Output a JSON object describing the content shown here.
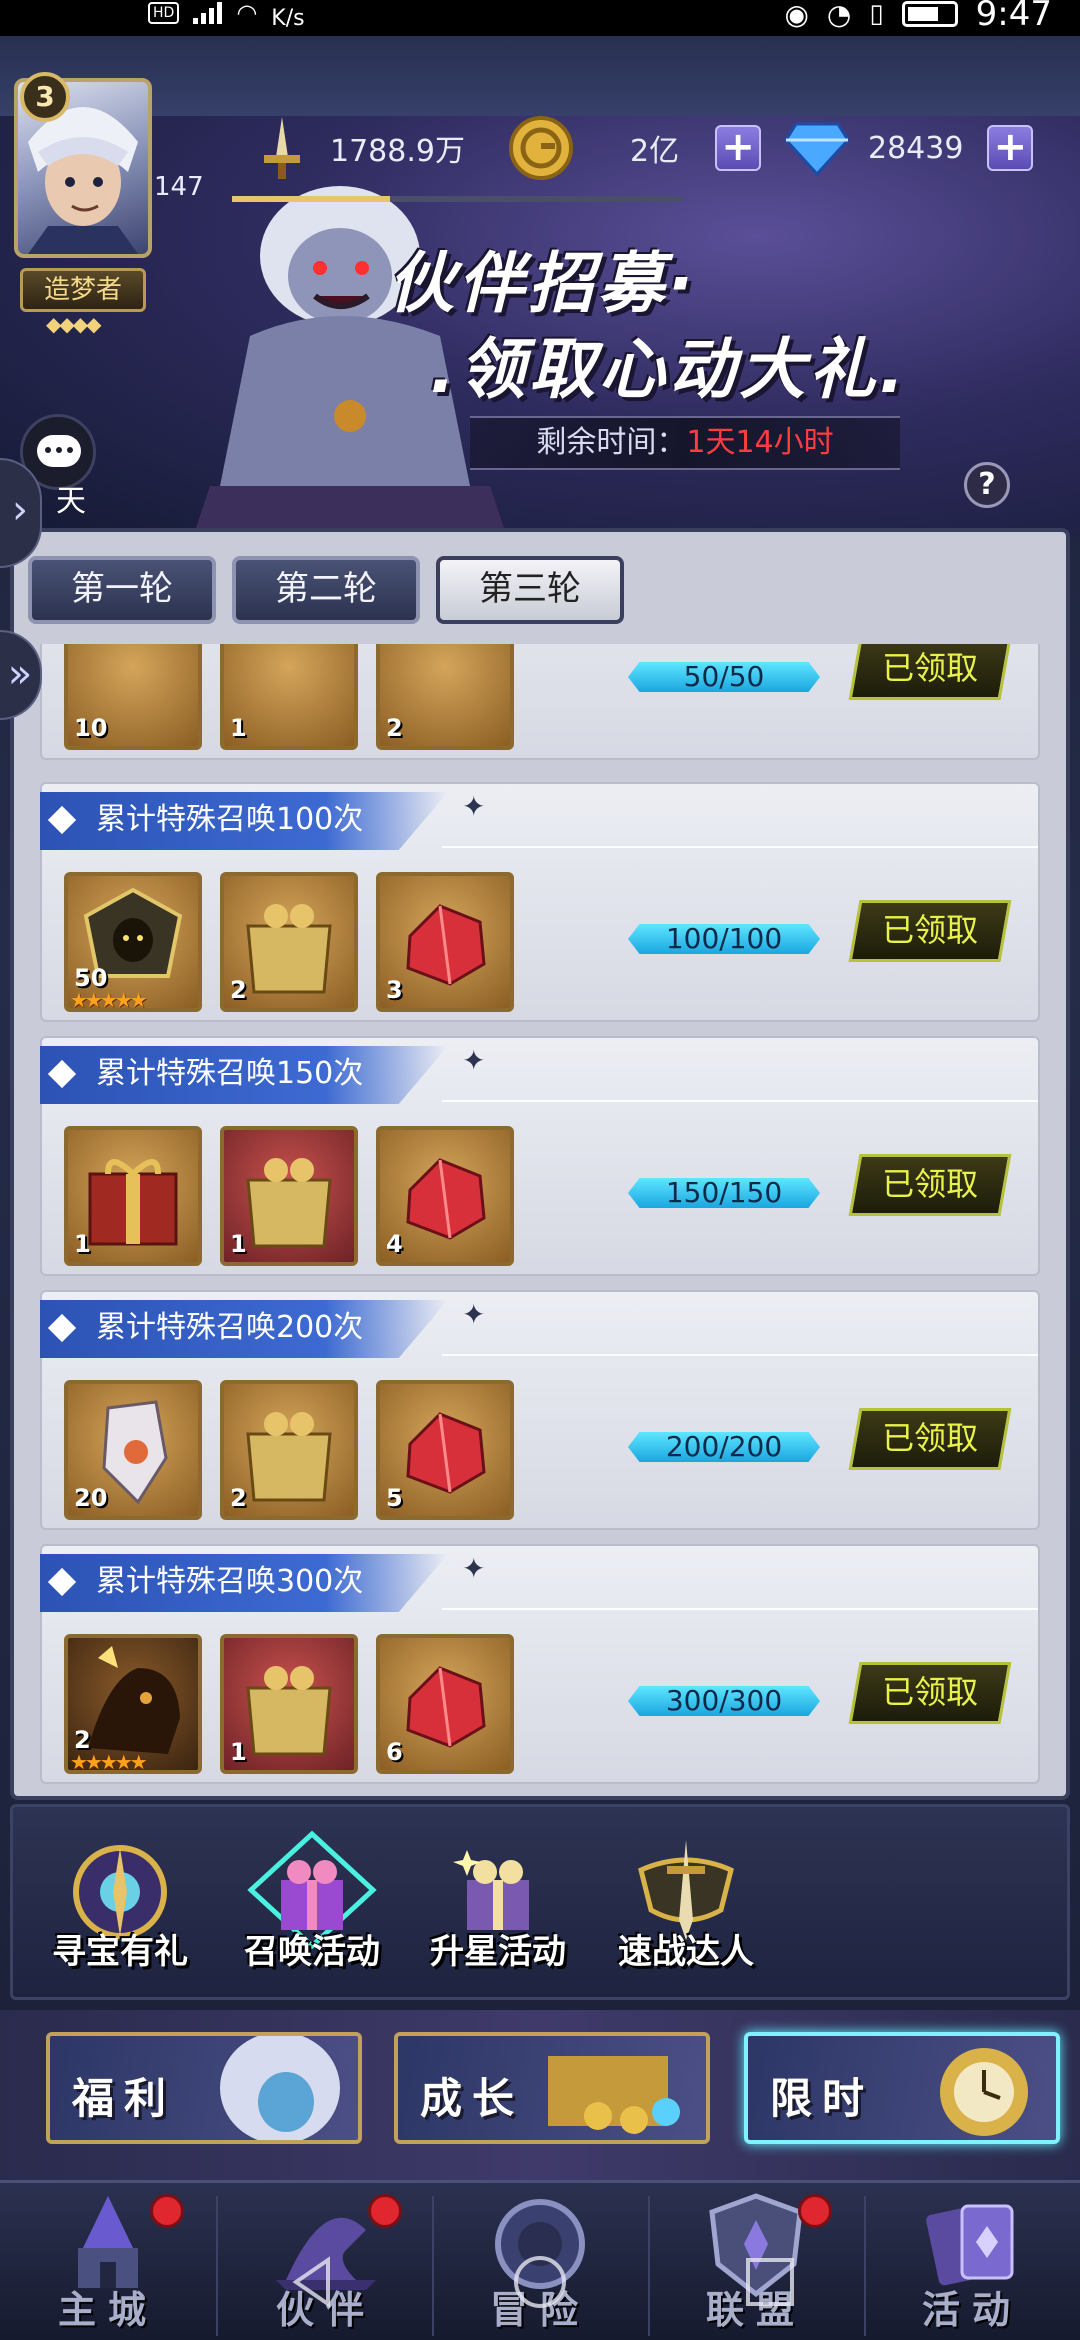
{
  "status_bar": {
    "hd": "HD",
    "speed": "K/s",
    "time": "9:47"
  },
  "player": {
    "level": "3",
    "xp": "147",
    "title": "造梦者",
    "stars": "◆◆◆◆",
    "xp_progress": 0.35
  },
  "resources": {
    "power": "1788.9万",
    "gold": "2亿",
    "diamonds": "28439"
  },
  "banner": {
    "title_line1": "伙伴招募·",
    "title_line2": ".领取心动大礼.",
    "timer_label": "剩余时间：",
    "timer_value": "1天14小时",
    "chat_label": "天"
  },
  "tabs": [
    {
      "label": "第一轮"
    },
    {
      "label": "第二轮"
    },
    {
      "label": "第三轮"
    }
  ],
  "rows": [
    {
      "title": "",
      "items": [
        {
          "count": "10"
        },
        {
          "count": "1"
        },
        {
          "count": "2"
        }
      ],
      "progress": "50/50",
      "status": "已领取"
    },
    {
      "title": "累计特殊召唤100次",
      "items": [
        {
          "count": "50",
          "stars": "★★★★★"
        },
        {
          "count": "2"
        },
        {
          "count": "3"
        }
      ],
      "progress": "100/100",
      "status": "已领取"
    },
    {
      "title": "累计特殊召唤150次",
      "items": [
        {
          "count": "1"
        },
        {
          "count": "1"
        },
        {
          "count": "4"
        }
      ],
      "progress": "150/150",
      "status": "已领取"
    },
    {
      "title": "累计特殊召唤200次",
      "items": [
        {
          "count": "20"
        },
        {
          "count": "2"
        },
        {
          "count": "5"
        }
      ],
      "progress": "200/200",
      "status": "已领取"
    },
    {
      "title": "累计特殊召唤300次",
      "items": [
        {
          "count": "2",
          "stars": "★★★★★"
        },
        {
          "count": "1"
        },
        {
          "count": "6"
        }
      ],
      "progress": "300/300",
      "status": "已领取"
    }
  ],
  "activities": [
    {
      "label": "寻宝有礼"
    },
    {
      "label": "召唤活动"
    },
    {
      "label": "升星活动"
    },
    {
      "label": "速战达人"
    }
  ],
  "big_buttons": [
    {
      "label": "福利"
    },
    {
      "label": "成长"
    },
    {
      "label": "限时"
    }
  ],
  "nav": [
    {
      "label": "主城"
    },
    {
      "label": "伙伴"
    },
    {
      "label": "冒险"
    },
    {
      "label": "联盟"
    },
    {
      "label": "活动"
    }
  ],
  "colors": {
    "accent_blue": "#3d6ad2",
    "claimed_yellow": "#e9f24a",
    "timer_red": "#ff3d3d",
    "progress_cyan": "#5fe6ff"
  }
}
